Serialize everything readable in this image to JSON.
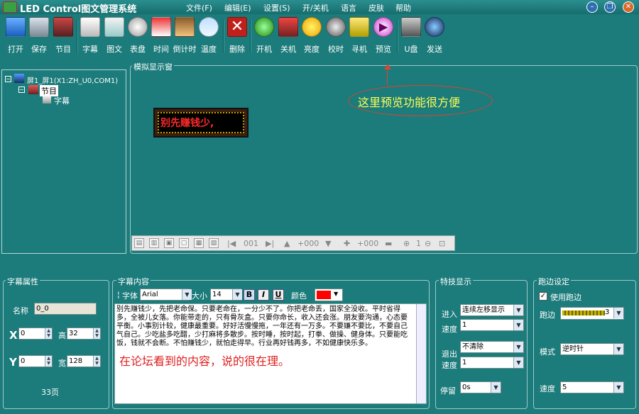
{
  "app": {
    "title": "LED Control图文管理系统"
  },
  "menu": [
    "文件(F)",
    "编辑(E)",
    "设置(S)",
    "开/关机",
    "语言",
    "皮肤",
    "帮助"
  ],
  "toolbar": [
    {
      "label": "打开",
      "icon": "folder-icon"
    },
    {
      "label": "保存",
      "icon": "disk-icon"
    },
    {
      "label": "节目",
      "icon": "program-icon"
    },
    {
      "label": "字幕",
      "icon": "subtitle-icon"
    },
    {
      "label": "图文",
      "icon": "image-text-icon"
    },
    {
      "label": "表盘",
      "icon": "clock-face-icon"
    },
    {
      "label": "时间",
      "icon": "time-icon"
    },
    {
      "label": "倒计时",
      "icon": "hourglass-icon"
    },
    {
      "label": "温度",
      "icon": "temperature-icon"
    },
    {
      "label": "删除",
      "icon": "delete-icon"
    },
    {
      "label": "开机",
      "icon": "power-on-icon"
    },
    {
      "label": "关机",
      "icon": "power-off-icon"
    },
    {
      "label": "亮度",
      "icon": "brightness-icon"
    },
    {
      "label": "校时",
      "icon": "sync-time-icon"
    },
    {
      "label": "寻机",
      "icon": "search-device-icon"
    },
    {
      "label": "预览",
      "icon": "preview-icon"
    },
    {
      "label": "U盘",
      "icon": "usb-icon"
    },
    {
      "label": "发送",
      "icon": "send-icon"
    }
  ],
  "tree": {
    "screen": "屏1_屏1(X1:ZH_U0,COM1)",
    "program": "节目",
    "subtitle": "字幕"
  },
  "preview": {
    "legend": "模拟显示窗",
    "led_text": "别先赚钱少,",
    "note": "这里预览功能很方便",
    "toolbar": {
      "page": "001",
      "pos1": "+000",
      "pos2": "+000",
      "zoom": "1"
    }
  },
  "props": {
    "legend": "字幕属性",
    "name_label": "名称",
    "name_value": "0_0",
    "x_label": "X",
    "x_value": "0",
    "height_label": "高",
    "height_value": "32",
    "y_label": "Y",
    "y_value": "0",
    "width_label": "宽",
    "width_value": "128",
    "pages": "33页"
  },
  "content": {
    "legend": "字幕内容",
    "font_label": "字体",
    "font_value": "Arial",
    "size_label": "大小",
    "size_value": "14",
    "bold": "B",
    "italic": "I",
    "underline": "U",
    "color_label": "颜色",
    "color_value": "#ff0000",
    "text": "别先赚钱少，先把老命保。只要老命在，一分少不了。你把老命丢，国家全没收。平时省得多，全被儿女落。你能带走的，只有骨灰盒。只要你命长，收入还会涨。朋友要沟通，心态要平衡。小事别计较，健康最重要。好好活慢慢拖，一年还有一万多。不要嫌不要比，不要自己气自己。少吃盐多吃醋，少打麻将多散步。按时睡，按时起，打拳、做操、健身体。只要能吃饭，钱就不会断。不怕赚钱少，就怕走得早。行业再好钱再多，不如健康快乐多。",
    "note": "在论坛看到的内容，说的很在理。"
  },
  "effects": {
    "legend": "特技显示",
    "enter_label": "进入",
    "enter_value": "连续左移显示",
    "enter_speed_label": "速度",
    "enter_speed_value": "1",
    "exit_label": "退出",
    "exit_value": "不清除",
    "exit_speed_label": "速度",
    "exit_speed_value": "1",
    "stay_label": "停留",
    "stay_value": "0s"
  },
  "border": {
    "legend": "跑边设定",
    "use_label": "使用跑边",
    "border_label": "跑边",
    "border_value": "3",
    "mode_label": "模式",
    "mode_value": "逆时针",
    "speed_label": "速度",
    "speed_value": "5"
  }
}
